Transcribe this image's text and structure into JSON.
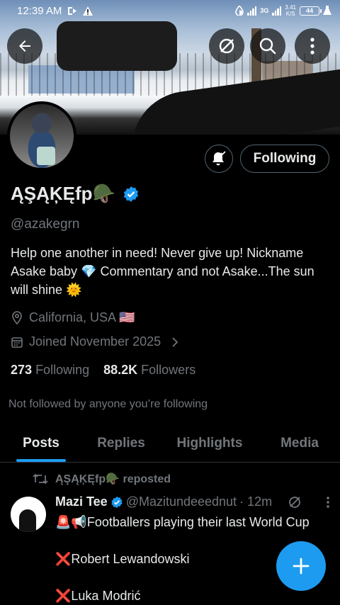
{
  "status_bar": {
    "time": "12:39 AM",
    "network_label": "3G",
    "speed_value": "3.41",
    "speed_unit": "K/S",
    "battery": "44"
  },
  "header": {
    "back_icon": "arrow-left-icon",
    "grok_icon": "grok-icon",
    "search_icon": "search-icon",
    "more_icon": "more-vertical-icon"
  },
  "profile": {
    "display_name": "ĄŞĄĶĘfp🪖",
    "handle": "@azakegrn",
    "bio": "Help one another in need! Never give up! Nickname Asake baby 💎 Commentary and not Asake...The sun will shine 🌞",
    "location": "California, USA 🇺🇸",
    "joined": "Joined November 2025",
    "following_count": "273",
    "following_label": "Following",
    "followers_count": "88.2K",
    "followers_label": "Followers",
    "not_followed_text": "Not followed by anyone you’re following",
    "follow_button_label": "Following"
  },
  "tabs": [
    {
      "label": "Posts",
      "active": true
    },
    {
      "label": "Replies",
      "active": false
    },
    {
      "label": "Highlights",
      "active": false
    },
    {
      "label": "Media",
      "active": false
    }
  ],
  "post": {
    "repost_label": "ĄŞĄĶĘfp🪖 reposted",
    "author_name": "Mazi Tee",
    "author_handle": "@Mazitundeeednut",
    "time": "· 12m",
    "line1": "🚨📢Footballers playing their last World Cup",
    "line2": "❌Robert Lewandowski",
    "line3": "❌Luka Modrić"
  },
  "colors": {
    "accent": "#1d9bf0",
    "background": "#000000",
    "text_primary": "#e7e9ea",
    "text_secondary": "#71767b",
    "border": "#2f3336"
  }
}
